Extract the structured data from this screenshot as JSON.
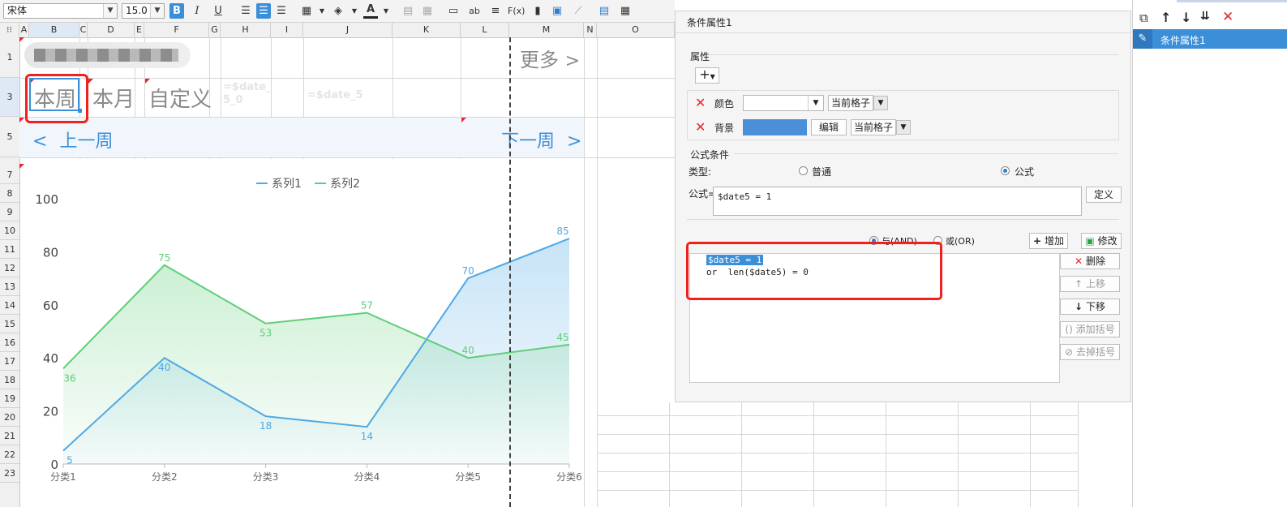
{
  "toolbar": {
    "font_name": "宋体",
    "font_size": "15.0",
    "bold": "B",
    "italic": "I",
    "underline": "U",
    "abc": "ab",
    "fx": "F(x)"
  },
  "columns": [
    "A",
    "B",
    "C",
    "D",
    "E",
    "F",
    "G",
    "H",
    "I",
    "J",
    "K",
    "L",
    "M",
    "N",
    "O"
  ],
  "rows": [
    "1",
    "3",
    "5",
    "7",
    "8",
    "9",
    "10",
    "11",
    "12",
    "13",
    "14",
    "15",
    "16",
    "17",
    "18",
    "19",
    "20",
    "21",
    "22",
    "23"
  ],
  "cells": {
    "more": "更多",
    "this_week": "本周",
    "this_month": "本月",
    "custom": "自定义",
    "formula_h": "=$date_ 5_0",
    "formula_j": "=$date_5",
    "prev_week": "上一周",
    "next_week": "下一周"
  },
  "chart_data": {
    "type": "area",
    "categories": [
      "分类1",
      "分类2",
      "分类3",
      "分类4",
      "分类5",
      "分类6"
    ],
    "series": [
      {
        "name": "系列1",
        "values": [
          5,
          40,
          18,
          14,
          70,
          85
        ],
        "color": "#4ea9e4"
      },
      {
        "name": "系列2",
        "values": [
          36,
          75,
          53,
          57,
          40,
          45
        ],
        "color": "#5fce79"
      }
    ],
    "ylim": [
      0,
      100
    ],
    "yticks": [
      "0",
      "20",
      "40",
      "60",
      "80",
      "100"
    ],
    "legend_position": "top",
    "grid": false
  },
  "dialog": {
    "title": "条件属性1",
    "attr_section": "属性",
    "color_label": "颜色",
    "color_scope": "当前格子",
    "bg_label": "背景",
    "bg_color": "#4a8fd8",
    "edit_btn": "编辑",
    "bg_scope": "当前格子",
    "formula_section": "公式条件",
    "type_label": "类型:",
    "type_normal": "普通",
    "type_formula": "公式",
    "formula_label": "公式=",
    "formula_value": "$date5 = 1",
    "define_btn": "定义",
    "and_label": "与(AND)",
    "or_label": "或(OR)",
    "add_btn": "增加",
    "modify_btn": "修改",
    "conditions": [
      "$date5 = 1",
      "or  len($date5) = 0"
    ],
    "delete_btn": "删除",
    "up_btn": "上移",
    "down_btn": "下移",
    "add_bracket_btn": "添加括号",
    "remove_bracket_btn": "去掉括号"
  },
  "right_panel": {
    "item": "条件属性1"
  }
}
